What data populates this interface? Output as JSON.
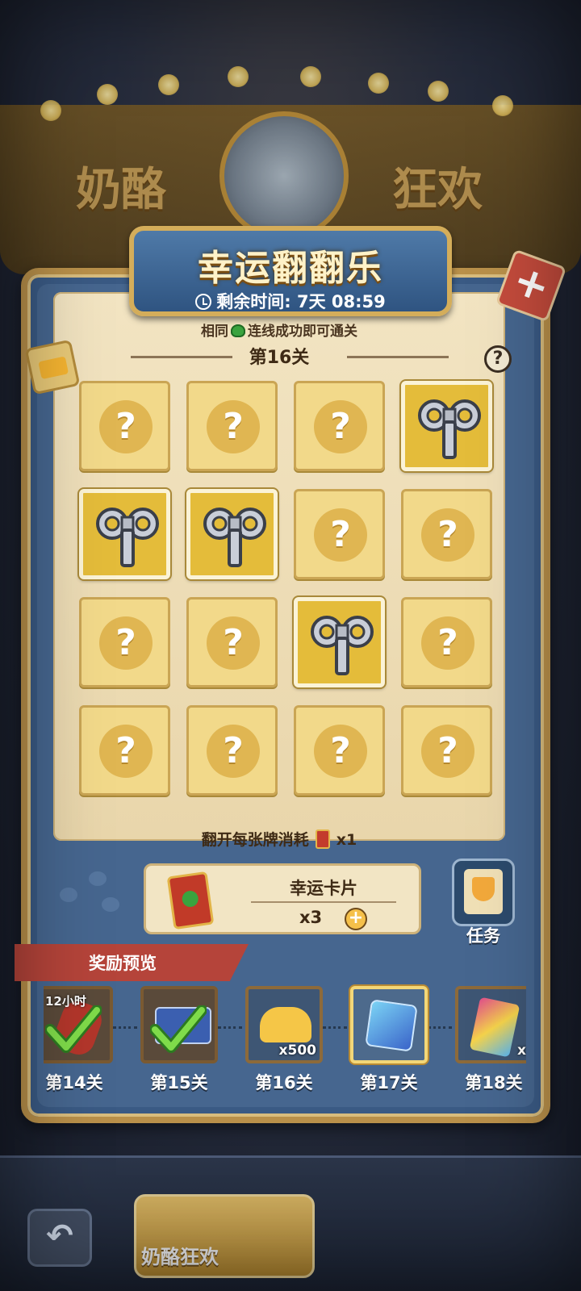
{
  "background": {
    "sign_left": "奶酪",
    "sign_right": "狂欢"
  },
  "header": {
    "title": "幸运翻翻乐",
    "time_label": "剩余时间:",
    "time_value": "7天 08:59"
  },
  "board": {
    "rule_prefix": "相同",
    "rule_suffix": "连线成功即可通关",
    "level": "第16关",
    "help": "?",
    "cards": [
      {
        "state": "hidden"
      },
      {
        "state": "hidden"
      },
      {
        "state": "hidden"
      },
      {
        "state": "revealed",
        "item": "wind-up-key"
      },
      {
        "state": "revealed",
        "item": "wind-up-key"
      },
      {
        "state": "revealed",
        "item": "wind-up-key"
      },
      {
        "state": "hidden"
      },
      {
        "state": "hidden"
      },
      {
        "state": "hidden"
      },
      {
        "state": "hidden"
      },
      {
        "state": "revealed",
        "item": "wind-up-key"
      },
      {
        "state": "hidden"
      },
      {
        "state": "hidden"
      },
      {
        "state": "hidden"
      },
      {
        "state": "hidden"
      },
      {
        "state": "hidden"
      }
    ],
    "hidden_symbol": "?",
    "cost_label": "翻开每张牌消耗",
    "cost_qty": "x1"
  },
  "lucky_card": {
    "name": "幸运卡片",
    "count": "x3",
    "plus": "+"
  },
  "task": {
    "label": "任务"
  },
  "rewards": {
    "title": "奖励预览",
    "items": [
      {
        "level": "第14关",
        "item": "sausage",
        "note": "12小时",
        "qty": "",
        "claimed": true,
        "current": false
      },
      {
        "level": "第15关",
        "item": "ticket",
        "note": "",
        "qty": "",
        "claimed": true,
        "current": false
      },
      {
        "level": "第16关",
        "item": "cheese",
        "note": "",
        "qty": "x500",
        "claimed": false,
        "current": false
      },
      {
        "level": "第17关",
        "item": "mystery-cube",
        "note": "",
        "qty": "",
        "claimed": false,
        "current": true
      },
      {
        "level": "第18关",
        "item": "card-pack",
        "note": "",
        "qty": "x",
        "claimed": false,
        "current": false
      }
    ]
  },
  "bottom": {
    "back": "↶",
    "tab_label": "奶酪狂欢"
  },
  "colors": {
    "panel": "#3a5a84",
    "frame": "#b9904a",
    "parchment": "#f2e4c2",
    "card": "#f2d98a",
    "revealed_card": "#e4bc3a",
    "ribbon": "#b5443a",
    "close_tag": "#c44b3c"
  }
}
